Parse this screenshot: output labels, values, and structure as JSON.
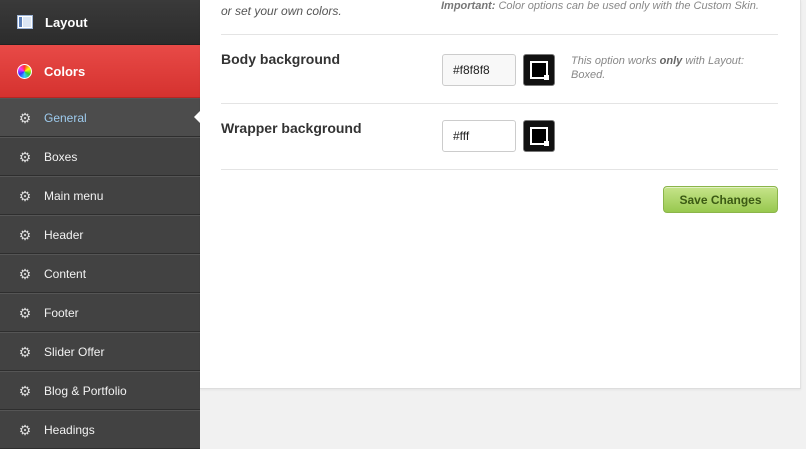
{
  "sidebar": {
    "top_item": {
      "label": "Layout",
      "icon": "layout-icon"
    },
    "section": {
      "label": "Colors",
      "icon": "color-wheel-icon"
    },
    "items": [
      {
        "label": "General",
        "active": true
      },
      {
        "label": "Boxes"
      },
      {
        "label": "Main menu"
      },
      {
        "label": "Header"
      },
      {
        "label": "Content"
      },
      {
        "label": "Footer"
      },
      {
        "label": "Slider Offer"
      },
      {
        "label": "Blog & Portfolio"
      },
      {
        "label": "Headings"
      }
    ]
  },
  "main": {
    "intro_text": "or set your own colors.",
    "important_label": "Important:",
    "important_text": " Color options can be used only with the Custom Skin.",
    "body_background": {
      "label": "Body background",
      "value": "#f8f8f8",
      "hint_pre": "This option works ",
      "hint_bold": "only",
      "hint_post": " with Layout: Boxed."
    },
    "wrapper_background": {
      "label": "Wrapper background",
      "value": "#fff"
    },
    "save_label": "Save Changes"
  },
  "colors": {
    "sidebar_bg": "#3f3f3f",
    "accent_red": "#d5322f",
    "active_text": "#9ecbee",
    "save_green": "#98c84f"
  }
}
